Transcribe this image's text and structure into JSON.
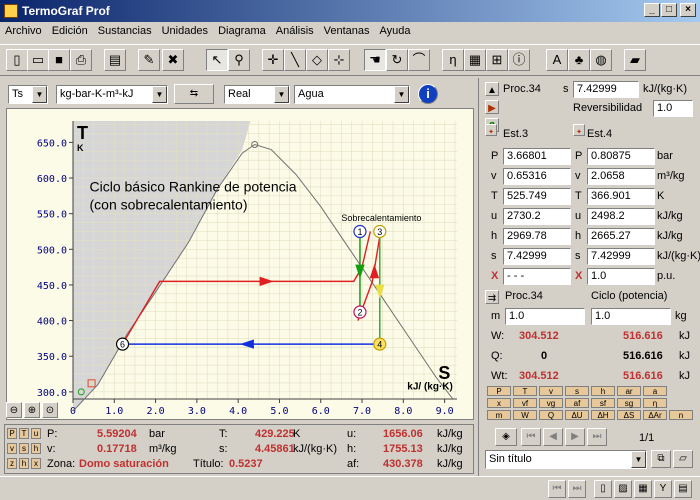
{
  "window": {
    "title": "TermoGraf Prof",
    "min": "_",
    "max": "□",
    "close": "×"
  },
  "menu": [
    "Archivo",
    "Edición",
    "Sustancias",
    "Unidades",
    "Diagrama",
    "Análisis",
    "Ventanas",
    "Ayuda"
  ],
  "selectors": {
    "diagram": "Ts",
    "units": "kg-bar-K-m³-kJ",
    "model": "Real",
    "substance": "Agua"
  },
  "plot": {
    "y_axis_letter": "T",
    "y_axis_unit": "K",
    "x_axis_letter": "S",
    "x_axis_unit": "kJ/ (kg·K)",
    "caption_line1": "Ciclo básico Rankine de potencia",
    "caption_line2": "(con sobrecalentamiento)",
    "annotation": "Sobrecalentamiento"
  },
  "chart_data": {
    "type": "line",
    "xlim": [
      0,
      9.3
    ],
    "ylim": [
      290,
      680
    ],
    "x_ticks": [
      "0",
      "1.0",
      "2.0",
      "3.0",
      "4.0",
      "5.0",
      "6.0",
      "7.0",
      "8.0",
      "9.0"
    ],
    "x_tick_values": [
      0,
      1,
      2,
      3,
      4,
      5,
      6,
      7,
      8,
      9
    ],
    "y_ticks": [
      "300.0",
      "350.0",
      "400.0",
      "450.0",
      "500.0",
      "550.0",
      "600.0",
      "650.0"
    ],
    "y_tick_values": [
      300,
      350,
      400,
      450,
      500,
      550,
      600,
      650
    ],
    "dome": [
      [
        0.0,
        273
      ],
      [
        0.6,
        310
      ],
      [
        1.3,
        380
      ],
      [
        2.0,
        440
      ],
      [
        2.8,
        510
      ],
      [
        3.5,
        585
      ],
      [
        4.1,
        635
      ],
      [
        4.4,
        647
      ],
      [
        4.8,
        640
      ],
      [
        5.4,
        605
      ],
      [
        6.0,
        560
      ],
      [
        6.7,
        500
      ],
      [
        7.4,
        440
      ],
      [
        8.1,
        380
      ],
      [
        8.8,
        320
      ],
      [
        9.2,
        290
      ]
    ],
    "saturated_solid_region": [
      [
        0.0,
        273
      ],
      [
        0.6,
        310
      ],
      [
        1.3,
        380
      ],
      [
        2.0,
        440
      ],
      [
        2.8,
        510
      ],
      [
        3.5,
        585
      ],
      [
        4.1,
        640
      ],
      [
        4.3,
        680
      ],
      [
        0.0,
        680
      ]
    ],
    "cycle_red": [
      [
        1.2,
        367
      ],
      [
        2.1,
        455
      ],
      [
        6.8,
        455
      ],
      [
        7.0,
        475
      ],
      [
        7.2,
        525
      ]
    ],
    "cycle_red_branch": [
      [
        6.9,
        400
      ],
      [
        7.25,
        455
      ],
      [
        7.45,
        525
      ]
    ],
    "cycle_blue": [
      [
        7.43,
        367
      ],
      [
        1.2,
        367
      ]
    ],
    "cycle_green": [
      [
        6.95,
        525
      ],
      [
        6.95,
        410
      ]
    ],
    "cycle_yellow": [
      [
        7.43,
        525
      ],
      [
        7.43,
        367
      ]
    ],
    "states": [
      {
        "label": "1",
        "x": 6.95,
        "y": 525
      },
      {
        "label": "2",
        "x": 6.95,
        "y": 412
      },
      {
        "label": "3",
        "x": 7.43,
        "y": 525
      },
      {
        "label": "4",
        "x": 7.43,
        "y": 367
      },
      {
        "label": "6",
        "x": 1.2,
        "y": 367
      }
    ],
    "small_markers": [
      {
        "x": 0.2,
        "y": 300
      },
      {
        "x": 0.45,
        "y": 312
      }
    ]
  },
  "bottom": {
    "row1": {
      "P_label": "P:",
      "P": "5.59204",
      "P_unit": "bar",
      "T_label": "T:",
      "T": "429.225",
      "T_unit": "K",
      "u_label": "u:",
      "u": "1656.06",
      "u_unit": "kJ/kg"
    },
    "row2": {
      "v_label": "v:",
      "v": "0.17718",
      "v_unit": "m³/kg",
      "s_label": "s:",
      "s": "4.45861",
      "s_unit": "kJ/(kg·K)",
      "h_label": "h:",
      "h": "1755.13",
      "h_unit": "kJ/kg"
    },
    "row3": {
      "zona_label": "Zona:",
      "zona": "Domo saturación",
      "titulo_label": "Título:",
      "titulo": "0.5237",
      "af_label": "af:",
      "af": "430.378",
      "af_unit": "kJ/kg"
    }
  },
  "right": {
    "proc_label": "Proc.34",
    "s_label": "s",
    "s_value": "7.42999",
    "s_unit": "kJ/(kg·K)",
    "rev_label": "Reversibilidad",
    "rev_value": "1.0",
    "est3": "Est.3",
    "est4": "Est.4",
    "props": [
      {
        "k": "P",
        "a": "3.66801",
        "b": "0.80875",
        "u": "bar"
      },
      {
        "k": "v",
        "a": "0.65316",
        "b": "2.0658",
        "u": "m³/kg"
      },
      {
        "k": "T",
        "a": "525.749",
        "b": "366.901",
        "u": "K"
      },
      {
        "k": "u",
        "a": "2730.2",
        "b": "2498.2",
        "u": "kJ/kg"
      },
      {
        "k": "h",
        "a": "2969.78",
        "b": "2665.27",
        "u": "kJ/kg"
      },
      {
        "k": "s",
        "a": "7.42999",
        "b": "7.42999",
        "u": "kJ/(kg·K)"
      },
      {
        "k": "X",
        "a": "- - -",
        "b": "1.0",
        "u": "p.u."
      }
    ],
    "proc34": "Proc.34",
    "ciclo": "Ciclo (potencia)",
    "m_label": "m",
    "m_a": "1.0",
    "m_b": "1.0",
    "m_unit": "kg",
    "W_label": "W:",
    "W_a": "304.512",
    "W_b": "516.616",
    "W_unit": "kJ",
    "Q_label": "Q:",
    "Q_a": "0",
    "Q_b": "516.616",
    "Q_unit": "kJ",
    "Wt_label": "Wt:",
    "Wt_a": "304.512",
    "Wt_b": "516.616",
    "Wt_unit": "kJ",
    "minibtns1": [
      "P",
      "T",
      "v",
      "s",
      "h",
      "ar",
      "a"
    ],
    "minibtns2": [
      "x",
      "vf",
      "vg",
      "af",
      "sf",
      "sg",
      "η"
    ],
    "minibtns3": [
      "m",
      "W",
      "Q",
      "ΔU",
      "ΔH",
      "ΔS",
      "ΔAr",
      "n"
    ],
    "page": "1/1",
    "doc": "Sin título"
  }
}
